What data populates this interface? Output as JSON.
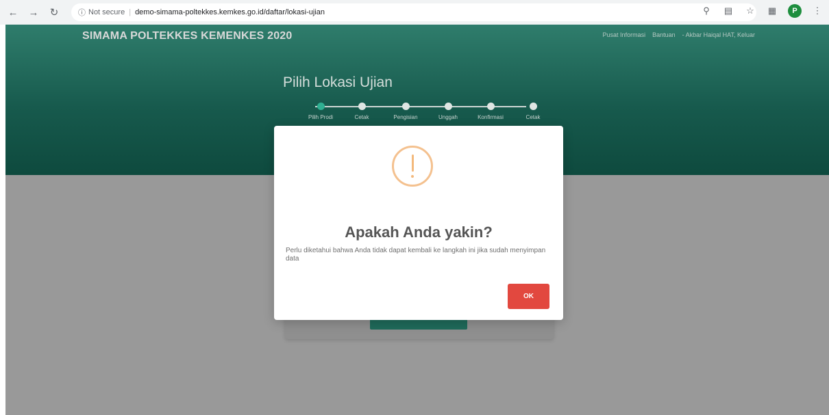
{
  "browser": {
    "security_label": "Not secure",
    "url": "demo-simama-poltekkes.kemkes.go.id/daftar/lokasi-ujian",
    "profile_initial": "P"
  },
  "header": {
    "brand": "SIMAMA POLTEKKES KEMENKES 2020",
    "nav": [
      "Pusat Informasi",
      "Bantuan",
      "- Akbar Haiqal HAT, Keluar"
    ]
  },
  "hero": {
    "title": "Pilih Lokasi Ujian",
    "steps": [
      "Pilih Prodi",
      "Cetak",
      "Pengisian",
      "Unggah",
      "Konfirmasi",
      "Cetak"
    ],
    "active_step": 0
  },
  "modal": {
    "icon": "warning-icon",
    "title": "Apakah Anda yakin?",
    "text": "Perlu diketahui bahwa Anda tidak dapat kembali ke langkah ini jika sudah menyimpan data",
    "ok_label": "OK"
  },
  "colors": {
    "primary": "#175a4d",
    "accent": "#2fb092",
    "warning": "#f4c18f",
    "danger": "#e2483f"
  }
}
